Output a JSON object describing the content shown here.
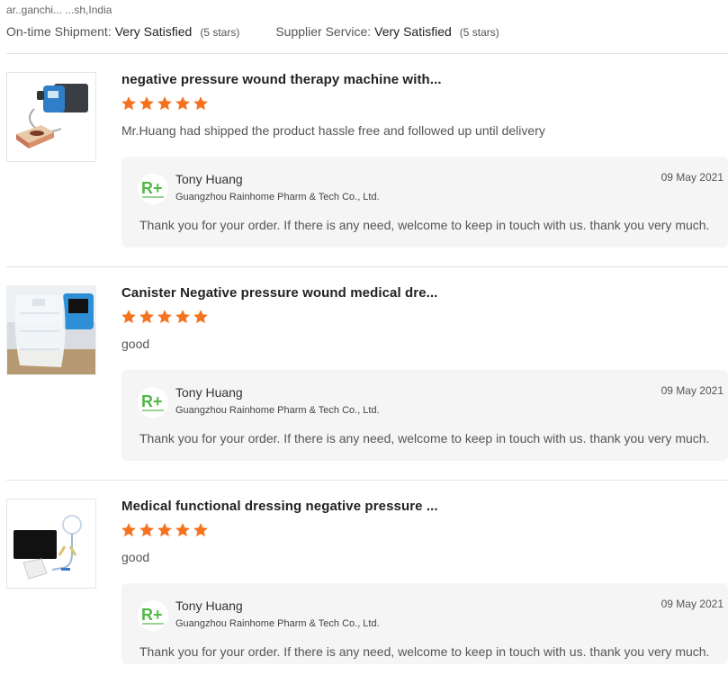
{
  "header": {
    "location": "ar..ganchi... ...sh,India",
    "ontime_label": "On-time Shipment:",
    "ontime_value": "Very Satisfied",
    "ontime_stars": "(5 stars)",
    "service_label": "Supplier Service:",
    "service_value": "Very Satisfied",
    "service_stars": "(5 stars)"
  },
  "colors": {
    "star": "#f7721e",
    "logo_green": "#52b848",
    "reply_bg": "#f5f5f5"
  },
  "reviews": [
    {
      "title": "negative pressure wound therapy machine with...",
      "rating": 5,
      "text": "Mr.Huang had shipped the product hassle free and followed up until delivery",
      "reply": {
        "name": "Tony Huang",
        "company": "Guangzhou Rainhome Pharm & Tech Co., Ltd.",
        "date": "09 May 2021",
        "message": "Thank you for your order. If there is any need, welcome to keep in touch with us. thank you very much."
      }
    },
    {
      "title": "Canister Negative pressure wound medical dre...",
      "rating": 5,
      "text": "good",
      "reply": {
        "name": "Tony Huang",
        "company": "Guangzhou Rainhome Pharm & Tech Co., Ltd.",
        "date": "09 May 2021",
        "message": "Thank you for your order. If there is any need, welcome to keep in touch with us. thank you very much."
      }
    },
    {
      "title": "Medical functional dressing negative pressure ...",
      "rating": 5,
      "text": "good",
      "reply": {
        "name": "Tony Huang",
        "company": "Guangzhou Rainhome Pharm & Tech Co., Ltd.",
        "date": "09 May 2021",
        "message": "Thank you for your order. If there is any need, welcome to keep in touch with us. thank you very much."
      }
    }
  ]
}
